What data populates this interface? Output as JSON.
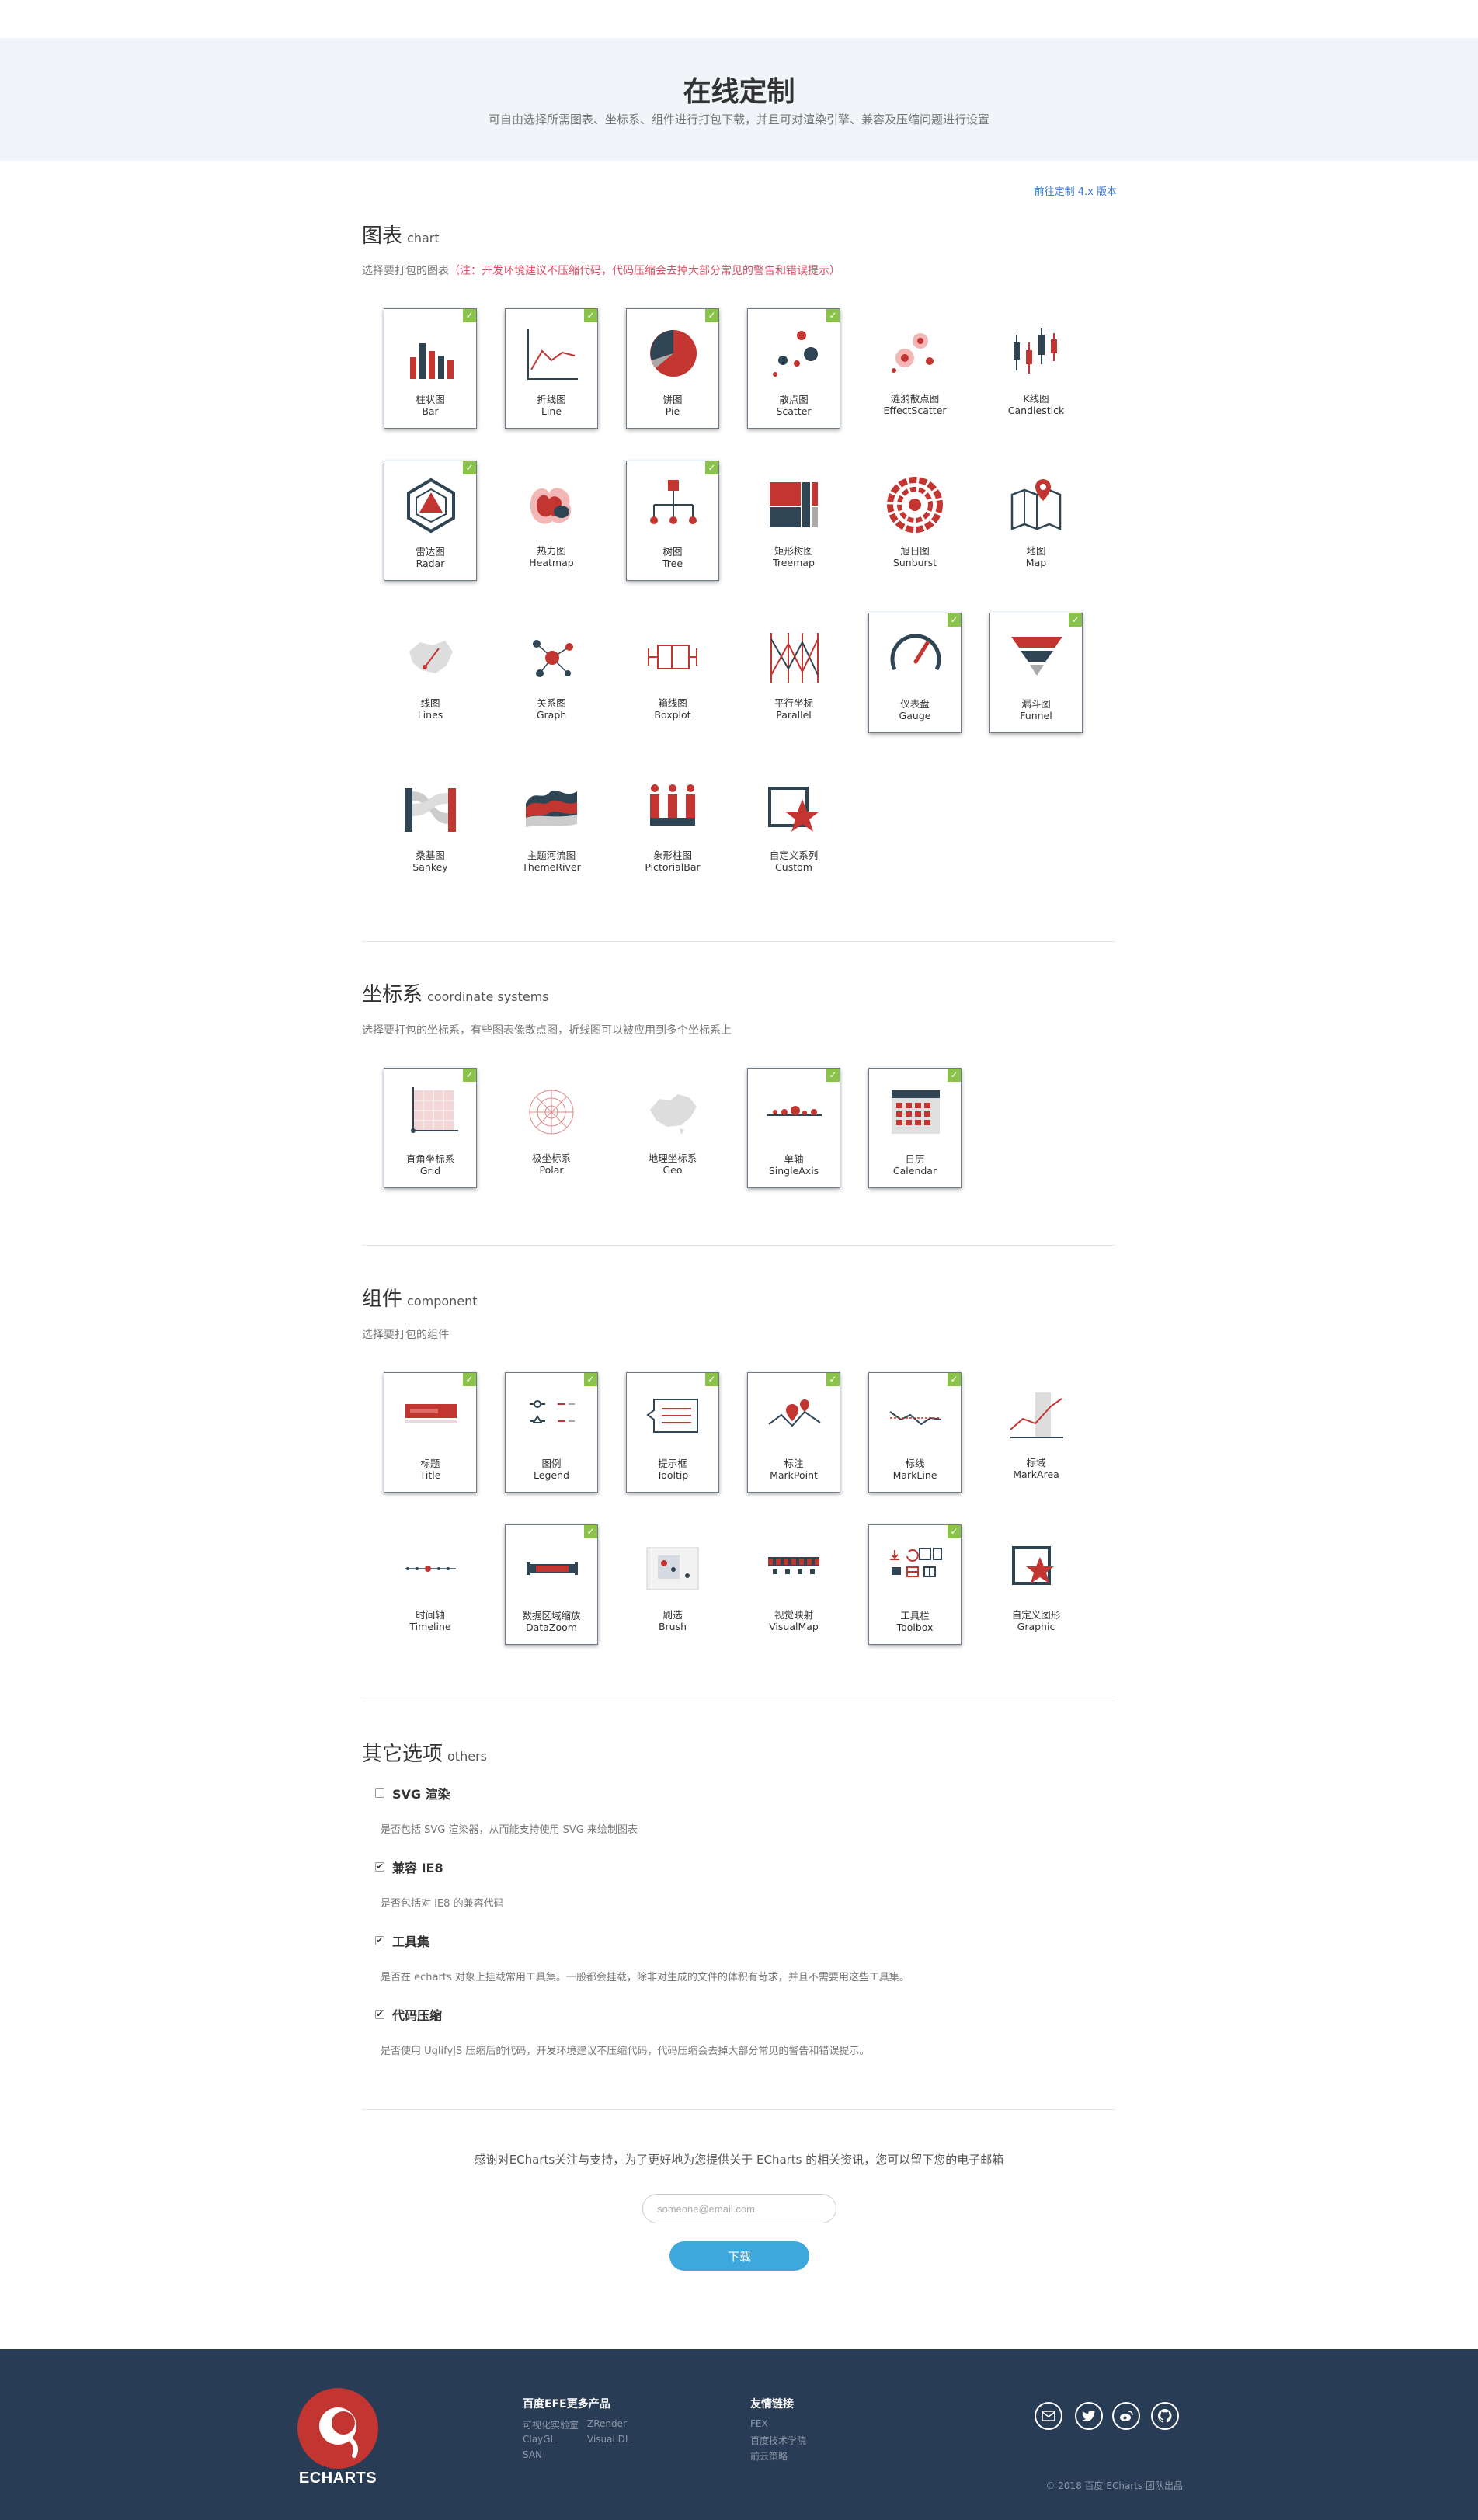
{
  "hero": {
    "title": "在线定制",
    "subtitle": "可自由选择所需图表、坐标系、组件进行打包下载，并且可对渲染引擎、兼容及压缩问题进行设置"
  },
  "v4_link": "前往定制 4.x 版本",
  "charts": {
    "title": "图表",
    "title_en": "chart",
    "desc": "选择要打包的图表",
    "warning": "（注：开发环境建议不压缩代码，代码压缩会去掉大部分常见的警告和错误提示）",
    "items": [
      {
        "zh": "柱状图",
        "en": "Bar",
        "checked": true,
        "icon": "bar-chart-icon"
      },
      {
        "zh": "折线图",
        "en": "Line",
        "checked": true,
        "icon": "line-chart-icon"
      },
      {
        "zh": "饼图",
        "en": "Pie",
        "checked": true,
        "icon": "pie-chart-icon"
      },
      {
        "zh": "散点图",
        "en": "Scatter",
        "checked": true,
        "icon": "scatter-chart-icon"
      },
      {
        "zh": "涟漪散点图",
        "en": "EffectScatter",
        "checked": false,
        "icon": "effect-scatter-icon"
      },
      {
        "zh": "K线图",
        "en": "Candlestick",
        "checked": false,
        "icon": "candlestick-icon"
      },
      {
        "zh": "雷达图",
        "en": "Radar",
        "checked": true,
        "icon": "radar-chart-icon"
      },
      {
        "zh": "热力图",
        "en": "Heatmap",
        "checked": false,
        "icon": "heatmap-icon"
      },
      {
        "zh": "树图",
        "en": "Tree",
        "checked": true,
        "icon": "tree-chart-icon"
      },
      {
        "zh": "矩形树图",
        "en": "Treemap",
        "checked": false,
        "icon": "treemap-icon"
      },
      {
        "zh": "旭日图",
        "en": "Sunburst",
        "checked": false,
        "icon": "sunburst-icon"
      },
      {
        "zh": "地图",
        "en": "Map",
        "checked": false,
        "icon": "map-icon"
      },
      {
        "zh": "线图",
        "en": "Lines",
        "checked": false,
        "icon": "lines-map-icon"
      },
      {
        "zh": "关系图",
        "en": "Graph",
        "checked": false,
        "icon": "graph-icon"
      },
      {
        "zh": "箱线图",
        "en": "Boxplot",
        "checked": false,
        "icon": "boxplot-icon"
      },
      {
        "zh": "平行坐标",
        "en": "Parallel",
        "checked": false,
        "icon": "parallel-icon"
      },
      {
        "zh": "仪表盘",
        "en": "Gauge",
        "checked": true,
        "icon": "gauge-icon"
      },
      {
        "zh": "漏斗图",
        "en": "Funnel",
        "checked": true,
        "icon": "funnel-icon"
      },
      {
        "zh": "桑基图",
        "en": "Sankey",
        "checked": false,
        "icon": "sankey-icon"
      },
      {
        "zh": "主题河流图",
        "en": "ThemeRiver",
        "checked": false,
        "icon": "theme-river-icon"
      },
      {
        "zh": "象形柱图",
        "en": "PictorialBar",
        "checked": false,
        "icon": "pictorial-bar-icon"
      },
      {
        "zh": "自定义系列",
        "en": "Custom",
        "checked": false,
        "icon": "custom-series-icon"
      }
    ]
  },
  "coords": {
    "title": "坐标系",
    "title_en": "coordinate systems",
    "desc": "选择要打包的坐标系，有些图表像散点图，折线图可以被应用到多个坐标系上",
    "items": [
      {
        "zh": "直角坐标系",
        "en": "Grid",
        "checked": true,
        "icon": "grid-icon"
      },
      {
        "zh": "极坐标系",
        "en": "Polar",
        "checked": false,
        "icon": "polar-icon"
      },
      {
        "zh": "地理坐标系",
        "en": "Geo",
        "checked": false,
        "icon": "geo-icon"
      },
      {
        "zh": "单轴",
        "en": "SingleAxis",
        "checked": true,
        "icon": "single-axis-icon"
      },
      {
        "zh": "日历",
        "en": "Calendar",
        "checked": true,
        "icon": "calendar-icon"
      }
    ]
  },
  "components": {
    "title": "组件",
    "title_en": "component",
    "desc": "选择要打包的组件",
    "items": [
      {
        "zh": "标题",
        "en": "Title",
        "checked": true,
        "icon": "title-icon"
      },
      {
        "zh": "图例",
        "en": "Legend",
        "checked": true,
        "icon": "legend-icon"
      },
      {
        "zh": "提示框",
        "en": "Tooltip",
        "checked": true,
        "icon": "tooltip-icon"
      },
      {
        "zh": "标注",
        "en": "MarkPoint",
        "checked": true,
        "icon": "mark-point-icon"
      },
      {
        "zh": "标线",
        "en": "MarkLine",
        "checked": true,
        "icon": "mark-line-icon"
      },
      {
        "zh": "标域",
        "en": "MarkArea",
        "checked": false,
        "icon": "mark-area-icon"
      },
      {
        "zh": "时间轴",
        "en": "Timeline",
        "checked": false,
        "icon": "timeline-icon"
      },
      {
        "zh": "数据区域缩放",
        "en": "DataZoom",
        "checked": true,
        "icon": "data-zoom-icon"
      },
      {
        "zh": "刷选",
        "en": "Brush",
        "checked": false,
        "icon": "brush-icon"
      },
      {
        "zh": "视觉映射",
        "en": "VisualMap",
        "checked": false,
        "icon": "visual-map-icon"
      },
      {
        "zh": "工具栏",
        "en": "Toolbox",
        "checked": true,
        "icon": "toolbox-icon"
      },
      {
        "zh": "自定义图形",
        "en": "Graphic",
        "checked": false,
        "icon": "graphic-icon"
      }
    ]
  },
  "others": {
    "title": "其它选项",
    "title_en": "others",
    "options": [
      {
        "label": "SVG 渲染",
        "checked": false,
        "desc": "是否包括 SVG 渲染器，从而能支持使用 SVG 来绘制图表"
      },
      {
        "label": "兼容 IE8",
        "checked": true,
        "desc": "是否包括对 IE8 的兼容代码"
      },
      {
        "label": "工具集",
        "checked": true,
        "desc": "是否在 echarts 对象上挂载常用工具集。一般都会挂载，除非对生成的文件的体积有苛求，并且不需要用这些工具集。"
      },
      {
        "label": "代码压缩",
        "checked": true,
        "desc": "是否使用 UglifyJS 压缩后的代码，开发环境建议不压缩代码，代码压缩会去掉大部分常见的警告和错误提示。"
      }
    ]
  },
  "subscribe": {
    "text": "感谢对ECharts关注与支持，为了更好地为您提供关于 ECharts 的相关资讯，您可以留下您的电子邮箱",
    "placeholder": "someone@email.com",
    "button": "下载"
  },
  "footer": {
    "logo_text": "ECHARTS",
    "products_title": "百度EFE更多产品",
    "products": [
      "可视化实验室",
      "ZRender",
      "ClayGL",
      "Visual DL",
      "SAN"
    ],
    "links_title": "友情链接",
    "links": [
      "FEX",
      "百度技术学院",
      "前云策略"
    ],
    "copyright": "© 2018 百度 ECharts 团队出品"
  },
  "colors": {
    "accent": "#c23531",
    "dark": "#2f4554",
    "check": "#8bc34a",
    "footer_bg": "#293c55",
    "button": "#3ea8dd"
  }
}
